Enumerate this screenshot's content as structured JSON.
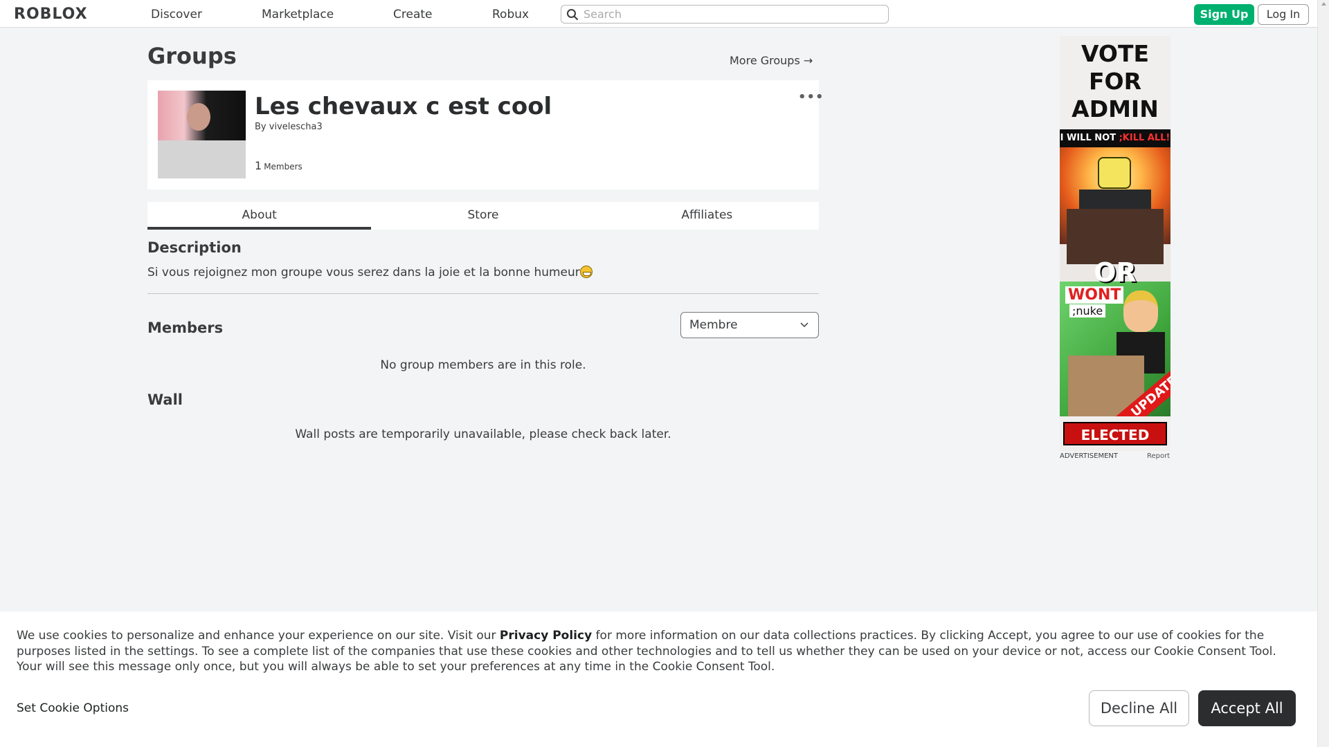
{
  "nav": {
    "logo": "ROBLOX",
    "links": [
      "Discover",
      "Marketplace",
      "Create",
      "Robux"
    ],
    "search_placeholder": "Search",
    "signup_label": "Sign Up",
    "login_label": "Log In"
  },
  "page": {
    "title": "Groups",
    "more_groups": "More Groups →"
  },
  "group": {
    "name": "Les chevaux c est cool",
    "by_prefix": "By",
    "owner": "vivelescha3",
    "member_count": "1",
    "members_label": "Members",
    "more_menu": "•••"
  },
  "tabs": [
    "About",
    "Store",
    "Affiliates"
  ],
  "active_tab": "About",
  "description": {
    "heading": "Description",
    "text": "Si vous rejoignez mon groupe vous serez dans la joie et la bonne humeur"
  },
  "members": {
    "heading": "Members",
    "role_selected": "Membre",
    "empty_message": "No group members are in this role."
  },
  "wall": {
    "heading": "Wall",
    "message": "Wall posts are temporarily unavailable, please check back later."
  },
  "ad": {
    "headline": "VOTE FOR ADMIN",
    "strip_prefix": "I WILL NOT ",
    "strip_highlight": ";KILL ALL!",
    "or_text": "OR",
    "wont_text": "WONT",
    "nuke_text": ";nuke",
    "update_text": "UPDATE!",
    "footer_text": "ELECTED ADMIN",
    "label": "ADVERTISEMENT",
    "report": "Report"
  },
  "cookie": {
    "text_before": "We use cookies to personalize and enhance your experience on our site. Visit our ",
    "privacy_link": "Privacy Policy",
    "text_after": " for more information on our data collections practices. By clicking Accept, you agree to our use of cookies for the purposes listed in the settings. To see a complete list of the companies that use these cookies and other technologies and to tell us whether they can be used on your device or not, access our Cookie Consent Tool. Your will see this message only once, but you will always be able to set your preferences at any time in the Cookie Consent Tool.",
    "set_options": "Set Cookie Options",
    "decline": "Decline All",
    "accept": "Accept All"
  },
  "colors": {
    "signup_green": "#00b06f",
    "accept_dark": "#2c2d2f",
    "page_bg": "#f2f4f5"
  }
}
